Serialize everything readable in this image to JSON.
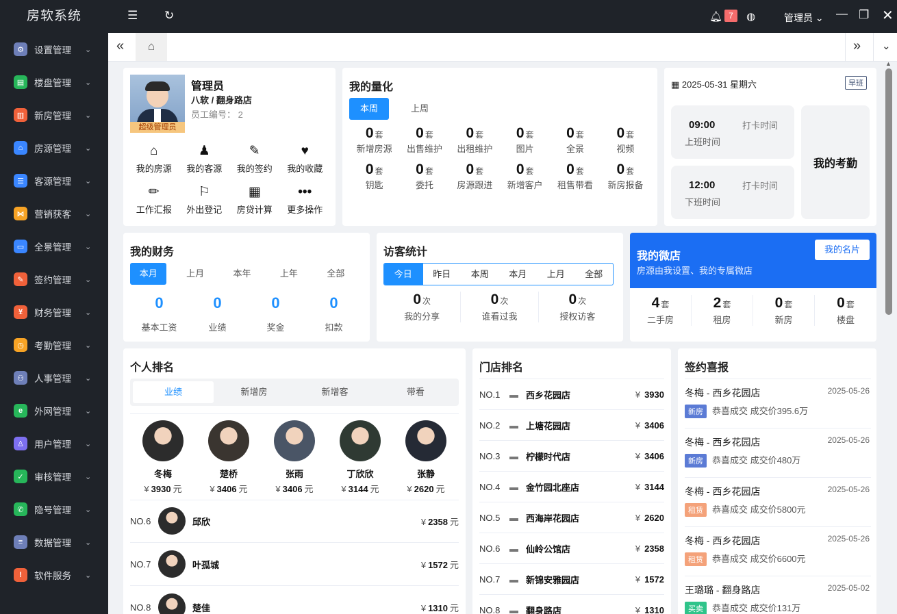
{
  "app": {
    "title": "房软系统"
  },
  "sidebar": {
    "items": [
      {
        "label": "设置管理",
        "color": "#6e7fb8",
        "glyph": "⚙"
      },
      {
        "label": "楼盘管理",
        "color": "#27b65a",
        "glyph": "▤"
      },
      {
        "label": "新房管理",
        "color": "#f0613a",
        "glyph": "▥"
      },
      {
        "label": "房源管理",
        "color": "#3a86ff",
        "glyph": "⌂"
      },
      {
        "label": "客源管理",
        "color": "#3a86ff",
        "glyph": "☰"
      },
      {
        "label": "营销获客",
        "color": "#f7a325",
        "glyph": "⋈"
      },
      {
        "label": "全景管理",
        "color": "#3a86ff",
        "glyph": "▭"
      },
      {
        "label": "签约管理",
        "color": "#f0613a",
        "glyph": "✎"
      },
      {
        "label": "财务管理",
        "color": "#f0613a",
        "glyph": "¥"
      },
      {
        "label": "考勤管理",
        "color": "#f7a325",
        "glyph": "◷"
      },
      {
        "label": "人事管理",
        "color": "#6e7fb8",
        "glyph": "⚇"
      },
      {
        "label": "外网管理",
        "color": "#27b65a",
        "glyph": "e"
      },
      {
        "label": "用户管理",
        "color": "#7d6ff0",
        "glyph": "♙"
      },
      {
        "label": "审核管理",
        "color": "#27b65a",
        "glyph": "✓"
      },
      {
        "label": "隐号管理",
        "color": "#27b65a",
        "glyph": "✆"
      },
      {
        "label": "数据管理",
        "color": "#6e7fb8",
        "glyph": "≡"
      },
      {
        "label": "软件服务",
        "color": "#f0613a",
        "glyph": "!"
      }
    ]
  },
  "topbar": {
    "notification_count": "7",
    "user": "管理员"
  },
  "profile": {
    "name": "管理员",
    "org": "八软 / 翻身路店",
    "emp_label": "员工编号：",
    "emp_no": "2",
    "role_badge": "超级管理员",
    "actions": [
      {
        "label": "我的房源",
        "icon": "house-icon",
        "glyph": "⌂"
      },
      {
        "label": "我的客源",
        "icon": "person-icon",
        "glyph": "♟"
      },
      {
        "label": "我的签约",
        "icon": "contract-icon",
        "glyph": "✎"
      },
      {
        "label": "我的收藏",
        "icon": "heart-icon",
        "glyph": "♥"
      },
      {
        "label": "工作汇报",
        "icon": "pencil-icon",
        "glyph": "✏"
      },
      {
        "label": "外出登记",
        "icon": "walk-icon",
        "glyph": "⚐"
      },
      {
        "label": "房贷计算",
        "icon": "calculator-icon",
        "glyph": "▦"
      },
      {
        "label": "更多操作",
        "icon": "more-icon",
        "glyph": "•••"
      }
    ]
  },
  "quant": {
    "title": "我的量化",
    "tabs": [
      "本周",
      "上周"
    ],
    "unit": "套",
    "items": [
      {
        "value": "0",
        "label": "新增房源"
      },
      {
        "value": "0",
        "label": "出售维护"
      },
      {
        "value": "0",
        "label": "出租维护"
      },
      {
        "value": "0",
        "label": "图片"
      },
      {
        "value": "0",
        "label": "全景"
      },
      {
        "value": "0",
        "label": "视频"
      },
      {
        "value": "0",
        "label": "钥匙"
      },
      {
        "value": "0",
        "label": "委托"
      },
      {
        "value": "0",
        "label": "房源跟进"
      },
      {
        "value": "0",
        "label": "新增客户"
      },
      {
        "value": "0",
        "label": "租售带看"
      },
      {
        "value": "0",
        "label": "新房报备"
      }
    ]
  },
  "attendance": {
    "date": "2025-05-31 星期六",
    "shift": "早班",
    "title": "我的考勤",
    "on": {
      "time": "09:00",
      "label": "上班时间",
      "action": "打卡时间"
    },
    "off": {
      "time": "12:00",
      "label": "下班时间",
      "action": "打卡时间"
    }
  },
  "finance": {
    "title": "我的财务",
    "tabs": [
      "本月",
      "上月",
      "本年",
      "上年",
      "全部"
    ],
    "items": [
      {
        "value": "0",
        "label": "基本工资"
      },
      {
        "value": "0",
        "label": "业绩"
      },
      {
        "value": "0",
        "label": "奖金"
      },
      {
        "value": "0",
        "label": "扣款"
      }
    ]
  },
  "visitors": {
    "title": "访客统计",
    "tabs": [
      "今日",
      "昨日",
      "本周",
      "本月",
      "上月",
      "全部"
    ],
    "unit": "次",
    "items": [
      {
        "value": "0",
        "label": "我的分享"
      },
      {
        "value": "0",
        "label": "谁看过我"
      },
      {
        "value": "0",
        "label": "授权访客"
      }
    ]
  },
  "microstore": {
    "title": "我的微店",
    "subtitle": "房源由我设置、我的专属微店",
    "button": "我的名片",
    "unit": "套",
    "items": [
      {
        "value": "4",
        "label": "二手房"
      },
      {
        "value": "2",
        "label": "租房"
      },
      {
        "value": "0",
        "label": "新房"
      },
      {
        "value": "0",
        "label": "楼盘"
      }
    ]
  },
  "ranking": {
    "title": "个人排名",
    "tabs": [
      "业绩",
      "新增房",
      "新增客",
      "带看"
    ],
    "currency": "¥",
    "unit": "元",
    "top": [
      {
        "name": "冬梅",
        "amount": "3930"
      },
      {
        "name": "楚桥",
        "amount": "3406"
      },
      {
        "name": "张雨",
        "amount": "3406"
      },
      {
        "name": "丁欣欣",
        "amount": "3144"
      },
      {
        "name": "张静",
        "amount": "2620"
      }
    ],
    "list": [
      {
        "no": "NO.6",
        "name": "邱欣",
        "amount": "2358"
      },
      {
        "no": "NO.7",
        "name": "叶孤城",
        "amount": "1572"
      },
      {
        "no": "NO.8",
        "name": "楚佳",
        "amount": "1310"
      }
    ]
  },
  "stores": {
    "title": "门店排名",
    "currency": "¥",
    "items": [
      {
        "no": "NO.1",
        "name": "西乡花园店",
        "amount": "3930"
      },
      {
        "no": "NO.2",
        "name": "上塘花园店",
        "amount": "3406"
      },
      {
        "no": "NO.3",
        "name": "柠檬时代店",
        "amount": "3406"
      },
      {
        "no": "NO.4",
        "name": "金竹园北座店",
        "amount": "3144"
      },
      {
        "no": "NO.5",
        "name": "西海岸花园店",
        "amount": "2620"
      },
      {
        "no": "NO.6",
        "name": "仙岭公馆店",
        "amount": "2358"
      },
      {
        "no": "NO.7",
        "name": "新锦安雅园店",
        "amount": "1572"
      },
      {
        "no": "NO.8",
        "name": "翻身路店",
        "amount": "1310"
      }
    ]
  },
  "deals": {
    "title": "签约喜报",
    "items": [
      {
        "who": "冬梅 - 西乡花园店",
        "date": "2025-05-26",
        "tag": "新房",
        "tag_color": "#5b7bd5",
        "text": "恭喜成交 成交价395.6万"
      },
      {
        "who": "冬梅 - 西乡花园店",
        "date": "2025-05-26",
        "tag": "新房",
        "tag_color": "#5b7bd5",
        "text": "恭喜成交 成交价480万"
      },
      {
        "who": "冬梅 - 西乡花园店",
        "date": "2025-05-26",
        "tag": "租赁",
        "tag_color": "#f4a27a",
        "text": "恭喜成交 成交价5800元"
      },
      {
        "who": "冬梅 - 西乡花园店",
        "date": "2025-05-26",
        "tag": "租赁",
        "tag_color": "#f4a27a",
        "text": "恭喜成交 成交价6600元"
      },
      {
        "who": "王璐璐 - 翻身路店",
        "date": "2025-05-02",
        "tag": "买卖",
        "tag_color": "#2fc48a",
        "text": "恭喜成交 成交价131万"
      }
    ]
  }
}
